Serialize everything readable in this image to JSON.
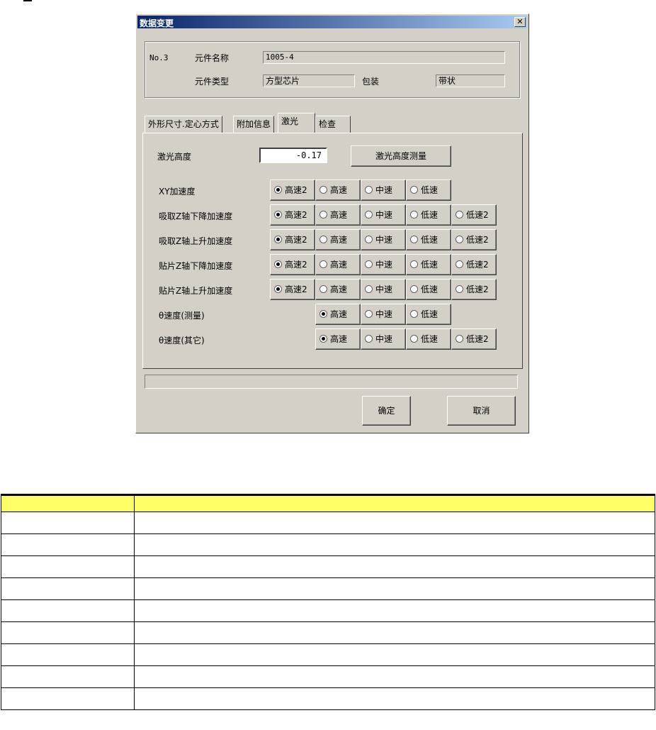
{
  "dialog": {
    "title": "数据变更",
    "close_glyph": "✕"
  },
  "info": {
    "number": "No.3",
    "part_name_label": "元件名称",
    "part_name_value": "1005-4",
    "part_type_label": "元件类型",
    "part_type_value": "方型芯片",
    "package_label": "包装",
    "package_value": "带状"
  },
  "tabs": [
    {
      "label": "外形尺寸.定心方式"
    },
    {
      "label": "附加信息"
    },
    {
      "label": "激光",
      "active": true
    },
    {
      "label": "检查"
    }
  ],
  "laser": {
    "height_label": "激光高度",
    "height_value": "-0.17",
    "measure_button": "激光高度测量"
  },
  "speed_rows": [
    {
      "label": "XY加速度",
      "options": [
        "高速2",
        "高速",
        "中速",
        "低速"
      ],
      "selected": 0,
      "start_col": 0
    },
    {
      "label": "吸取Z轴下降加速度",
      "options": [
        "高速2",
        "高速",
        "中速",
        "低速",
        "低速2"
      ],
      "selected": 0,
      "start_col": 0
    },
    {
      "label": "吸取Z轴上升加速度",
      "options": [
        "高速2",
        "高速",
        "中速",
        "低速",
        "低速2"
      ],
      "selected": 0,
      "start_col": 0
    },
    {
      "label": "贴片Z轴下降加速度",
      "options": [
        "高速2",
        "高速",
        "中速",
        "低速",
        "低速2"
      ],
      "selected": 0,
      "start_col": 0
    },
    {
      "label": "贴片Z轴上升加速度",
      "options": [
        "高速2",
        "高速",
        "中速",
        "低速",
        "低速2"
      ],
      "selected": 0,
      "start_col": 0
    },
    {
      "label": "θ速度(测量)",
      "options": [
        "高速",
        "中速",
        "低速"
      ],
      "selected": 0,
      "start_col": 1
    },
    {
      "label": "θ速度(其它)",
      "options": [
        "高速",
        "中速",
        "低速",
        "低速2"
      ],
      "selected": 0,
      "start_col": 1
    }
  ],
  "buttons": {
    "ok": "确定",
    "cancel": "取消"
  },
  "table": {
    "header": [
      "",
      ""
    ],
    "rows": [
      [
        "",
        ""
      ],
      [
        "",
        ""
      ],
      [
        "",
        ""
      ],
      [
        "",
        ""
      ],
      [
        "",
        ""
      ],
      [
        "",
        ""
      ],
      [
        "",
        ""
      ],
      [
        "",
        ""
      ],
      [
        "",
        ""
      ]
    ]
  }
}
